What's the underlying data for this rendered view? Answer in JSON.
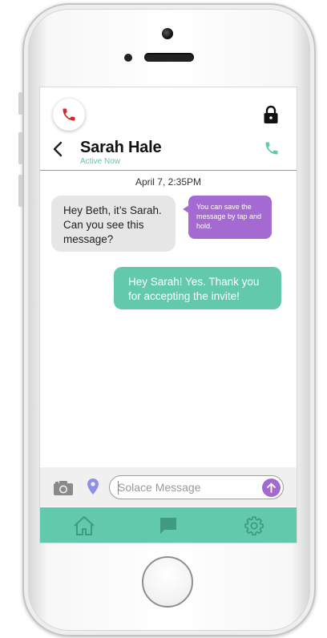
{
  "colors": {
    "accent_teal": "#63c9ad",
    "accent_purple": "#a56ad1",
    "call_red": "#d42a2a",
    "incoming_bubble": "#e6e6e6"
  },
  "header": {
    "call_icon": "phone-red-icon",
    "lock_icon": "lock-icon",
    "back_icon": "chevron-left-icon",
    "contact_name": "Sarah Hale",
    "contact_status": "Active Now",
    "voice_call_icon": "phone-icon"
  },
  "conversation": {
    "timestamp": "April 7, 2:35PM",
    "messages": [
      {
        "direction": "incoming",
        "text": "Hey Beth, it’s Sarah. Can you see this message?"
      },
      {
        "direction": "outgoing",
        "text": "Hey Sarah! Yes. Thank you for accepting the invite!"
      }
    ],
    "tooltip": "You can save the message by tap and hold."
  },
  "composer": {
    "camera_icon": "camera-icon",
    "location_icon": "location-pin-icon",
    "placeholder": "Solace Message",
    "value": "",
    "send_icon": "arrow-up-icon"
  },
  "tabbar": {
    "tabs": [
      {
        "icon": "home-icon"
      },
      {
        "icon": "chat-icon"
      },
      {
        "icon": "gear-icon"
      }
    ]
  }
}
